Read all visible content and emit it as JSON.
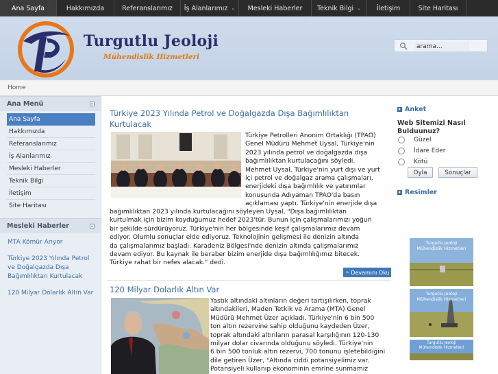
{
  "nav": {
    "items": [
      {
        "label": "Ana Sayfa",
        "dropdown": false,
        "active": true
      },
      {
        "label": "Hakkımızda",
        "dropdown": false
      },
      {
        "label": "Referanslarımız",
        "dropdown": false
      },
      {
        "label": "İş Alanlarımız",
        "dropdown": true
      },
      {
        "label": "Mesleki Haberler",
        "dropdown": false
      },
      {
        "label": "Teknik Bilgi",
        "dropdown": true
      },
      {
        "label": "İletişim",
        "dropdown": false
      },
      {
        "label": "Site Haritası",
        "dropdown": false
      }
    ]
  },
  "header": {
    "title": "Turgutlu Jeoloji",
    "subtitle": "Mühendislik Hizmetleri",
    "search_placeholder": "arama..."
  },
  "breadcrumb": {
    "home": "Home"
  },
  "left": {
    "menu_title": "Ana Menü",
    "menu": [
      "Ana Sayfa",
      "Hakkımızda",
      "Referanslarımız",
      "İş Alanlarımız",
      "Mesleki Haberler",
      "Teknik Bilgi",
      "İletişim",
      "Site Haritası"
    ],
    "news_title": "Mesleki Haberler",
    "news": [
      "MTA Kömür Arıyor",
      "Türkiye 2023 Yılında Petrol ve Doğalgazda Dışa Bağımlılıktan Kurtulacak",
      "120 Milyar Dolarlık Altın Var"
    ]
  },
  "articles": [
    {
      "title": "Türkiye 2023 Yılında Petrol ve Doğalgazda Dışa Bağımlılıktan Kurtulacak",
      "wrap_lines": [
        "Türkiye Petrolleri Anonim Ortaklığı (TPAO)",
        "Genel Müdürü Mehmet Uysal, Türkiye'nin",
        "2023 yılında petrol ve doğalgazda dışa",
        "bağımlılıktan kurtulacağını söyledi.",
        "Mehmet Uysal, Türkiye'nin yurt dışı ve yurt",
        "içi petrol ve doğalgaz arama çalışmaları,",
        "enerjideki dışa bağımlılık ve yatırımlar",
        "konusunda Adıyaman TPAO'da basın",
        "açıklaması yaptı. Türkiye'nin enerjide dışa"
      ],
      "full_lines": [
        "bağımlılıktan 2023 yılında kurtulacağını söyleyen Uysal, \"Dışa bağımlılıktan",
        "kurtulmak için bizim koyduğumuz hedef 2023'tür. Bunun için çalışmalarımızı yoğun",
        "bir şekilde sürdürüyoruz. Türkiye'nin her bölgesinde keşif çalışmalarımız devam",
        "ediyor. Olumlu sonuçlar elde ediyoruz. Teknolojinin gelişmesi ile denizin altında",
        "da çalışmalarımız başladı. Karadeniz Bölgesi'nde denizin altında çalışmalarımız",
        "devam ediyor. Bu kaynak ile beraber bizim enerjide dışa bağımlılığımız bitecek.",
        "Türkiye rahat bir nefes alacak.\" dedi."
      ],
      "more": "Devamını Oku"
    },
    {
      "title": "120 Milyar Dolarlık Altın Var",
      "wrap_lines": [
        "Yastık altındaki altınların değeri tartışılırken, toprak",
        "altındakileri, Maden Tetkik ve Arama (MTA) Genel",
        "Müdürü Mehmet Üzer açıkladı. Türkiye'nin 6 bin 500",
        "ton altın rezervine sahip olduğunu kaydeden Üzer,",
        "toprak altındaki altınların parasal karşılığının 120-130",
        "milyar dolar civarında olduğunu söyledi. Türkiye'nin",
        "6 bin 500 tonluk altın rezervi, 700 tonunu işletebildiğini",
        "dile getiren Üzer, \"Altında ciddi potansiyelimiz var.",
        "Potansiyeli kullanıp ekonominin emrine sunmamız"
      ]
    }
  ],
  "right": {
    "poll_title": "Anket",
    "poll_question": "Web Sitemizi Nasıl Bulduunuz?",
    "poll_options": [
      "Güzel",
      "İdare Eder",
      "Kötü"
    ],
    "vote_label": "Oyla",
    "results_label": "Sonuçlar",
    "images_title": "Resimler",
    "thumb_caption_1": "Turgutlu Jeoloji",
    "thumb_caption_2": "Mühendislik Hizmetleri"
  },
  "colors": {
    "nav_bg": "#2b2b2b",
    "link": "#3a6ea8",
    "brand_blue": "#2a2f6b",
    "brand_orange": "#e07a10",
    "active_menu": "#4a7fc1"
  }
}
